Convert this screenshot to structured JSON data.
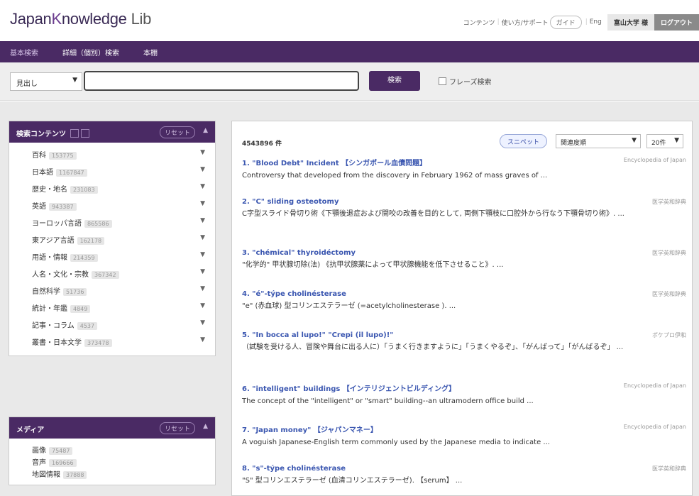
{
  "header": {
    "logo_main": "Japan",
    "logo_k": "K",
    "logo_rest": "nowledge",
    "logo_lib": "Lib",
    "nav": [
      "コンテンツ",
      "使い方/サポート",
      "ガイド",
      "Eng"
    ],
    "institution": "富山大学 様",
    "logout": "ログアウト"
  },
  "tabs": [
    "基本検索",
    "詳細（個別）検索",
    "本棚"
  ],
  "search": {
    "field_select": "見出し",
    "query": "",
    "button": "検索",
    "phrase_label": "フレーズ検索"
  },
  "content_panel": {
    "title": "検索コンテンツ",
    "reset": "リセット",
    "categories": [
      {
        "label": "百科",
        "count": "153775"
      },
      {
        "label": "日本語",
        "count": "1167847"
      },
      {
        "label": "歴史・地名",
        "count": "231083"
      },
      {
        "label": "英語",
        "count": "943387"
      },
      {
        "label": "ヨーロッパ言語",
        "count": "865586"
      },
      {
        "label": "東アジア言語",
        "count": "162178"
      },
      {
        "label": "用語・情報",
        "count": "214359"
      },
      {
        "label": "人名・文化・宗教",
        "count": "367342"
      },
      {
        "label": "自然科学",
        "count": "51736"
      },
      {
        "label": "統計・年鑑",
        "count": "4849"
      },
      {
        "label": "記事・コラム",
        "count": "4537"
      },
      {
        "label": "叢書・日本文学",
        "count": "373478"
      }
    ]
  },
  "media_panel": {
    "title": "メディア",
    "reset": "リセット",
    "items": [
      {
        "label": "画像",
        "count": "75487"
      },
      {
        "label": "音声",
        "count": "169666"
      },
      {
        "label": "地図情報",
        "count": "37888"
      }
    ]
  },
  "results": {
    "total": "4543896 件",
    "snippet_btn": "スニペット",
    "sort": "関連度順",
    "per_page": "20件",
    "items": [
      {
        "title": "1. \"Blood Debt\" Incident 【シンガポール血債問題】",
        "source": "Encyclopedia of Japan",
        "snippet": "Controversy that developed from the discovery in February 1962 of mass graves of ..."
      },
      {
        "title": "2. \"C\" sliding osteotomy",
        "source": "医学英和辞典",
        "snippet": "C字型スライド骨切り術《下顎後退症および開咬の改善を目的として, 両側下顎枝に口腔外から行なう下顎骨切り術》. ..."
      },
      {
        "title": "3. \"chémical\" thyroidéctomy",
        "source": "医学英和辞典",
        "snippet": "\"化学的\" 甲状腺切除(法) 《抗甲状腺薬によって甲状腺機能を低下させること》. ..."
      },
      {
        "title": "4. \"é\"-týpe cholinésterase",
        "source": "医学英和辞典",
        "snippet": "\"e\" (赤血球) 型コリンエステラーゼ (=acetylcholinesterase ). ..."
      },
      {
        "title": "5. \"In bocca al lupo!\" \"Crepi (il lupo)!\"",
        "source": "ポケプロ伊和",
        "snippet": "（試験を受ける人、冒険や舞台に出る人に）「うまく行きますように」「うまくやるぞ」、「がんばって」「がんばるぞ」 ..."
      },
      {
        "title": "6. \"intelligent\" buildings 【インテリジェントビルディング】",
        "source": "Encyclopedia of Japan",
        "snippet": "The concept of the \"intelligent\" or \"smart\" building--an ultramodern office build ..."
      },
      {
        "title": "7. \"Japan money\" 【ジャパンマネー】",
        "source": "Encyclopedia of Japan",
        "snippet": "A voguish Japanese-English term commonly used by the Japanese media to indicate ..."
      },
      {
        "title": "8. \"s\"-týpe cholinésterase",
        "source": "医学英和辞典",
        "snippet": "\"S\" 型コリンエステラーゼ (血清コリンエステラーゼ). 【serum】 ..."
      }
    ]
  }
}
